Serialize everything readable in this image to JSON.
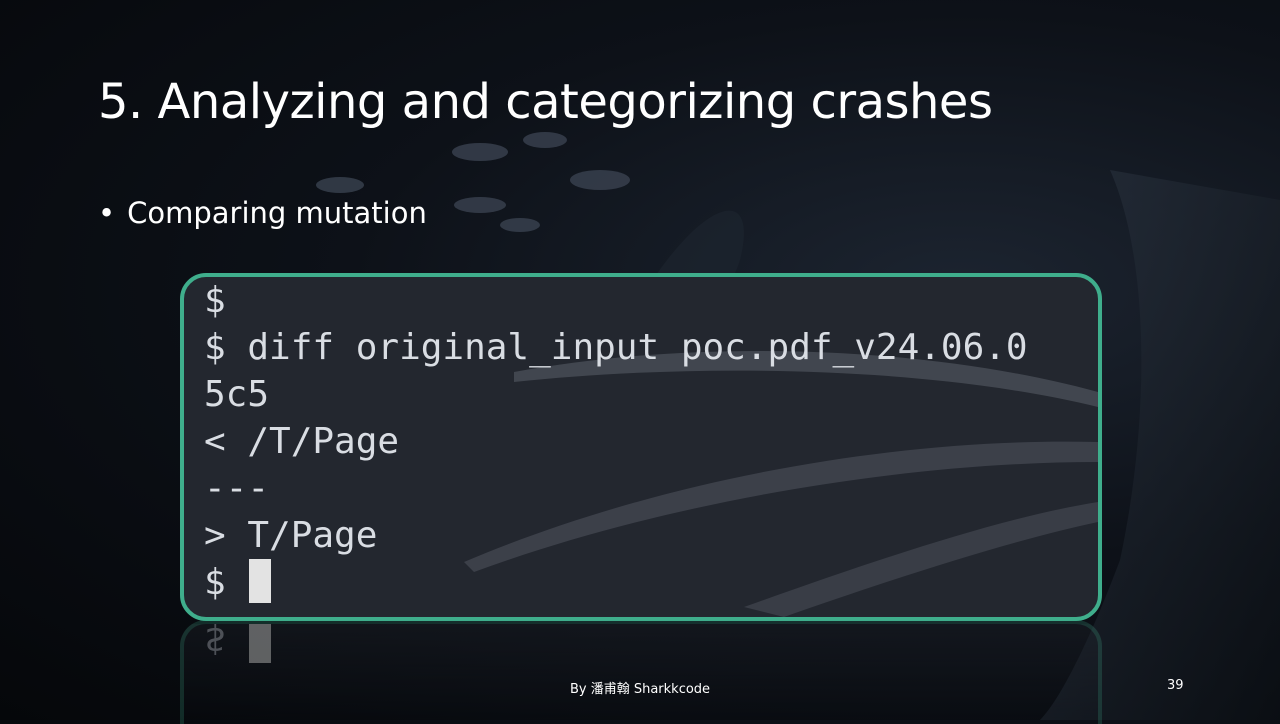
{
  "slide": {
    "title": "5. Analyzing and categorizing crashes",
    "bullet": "Comparing mutation",
    "bullet_marker": "•"
  },
  "terminal": {
    "lines": [
      "$",
      "$ diff original_input poc.pdf_v24.06.0",
      "5c5",
      "< /T/Page",
      "---",
      "> T/Page",
      "$ "
    ],
    "border_color": "#3fae8c",
    "background_color": "#23272f"
  },
  "footer": {
    "credit": "By 潘甫翰 Sharkkcode",
    "page_number": "39"
  }
}
